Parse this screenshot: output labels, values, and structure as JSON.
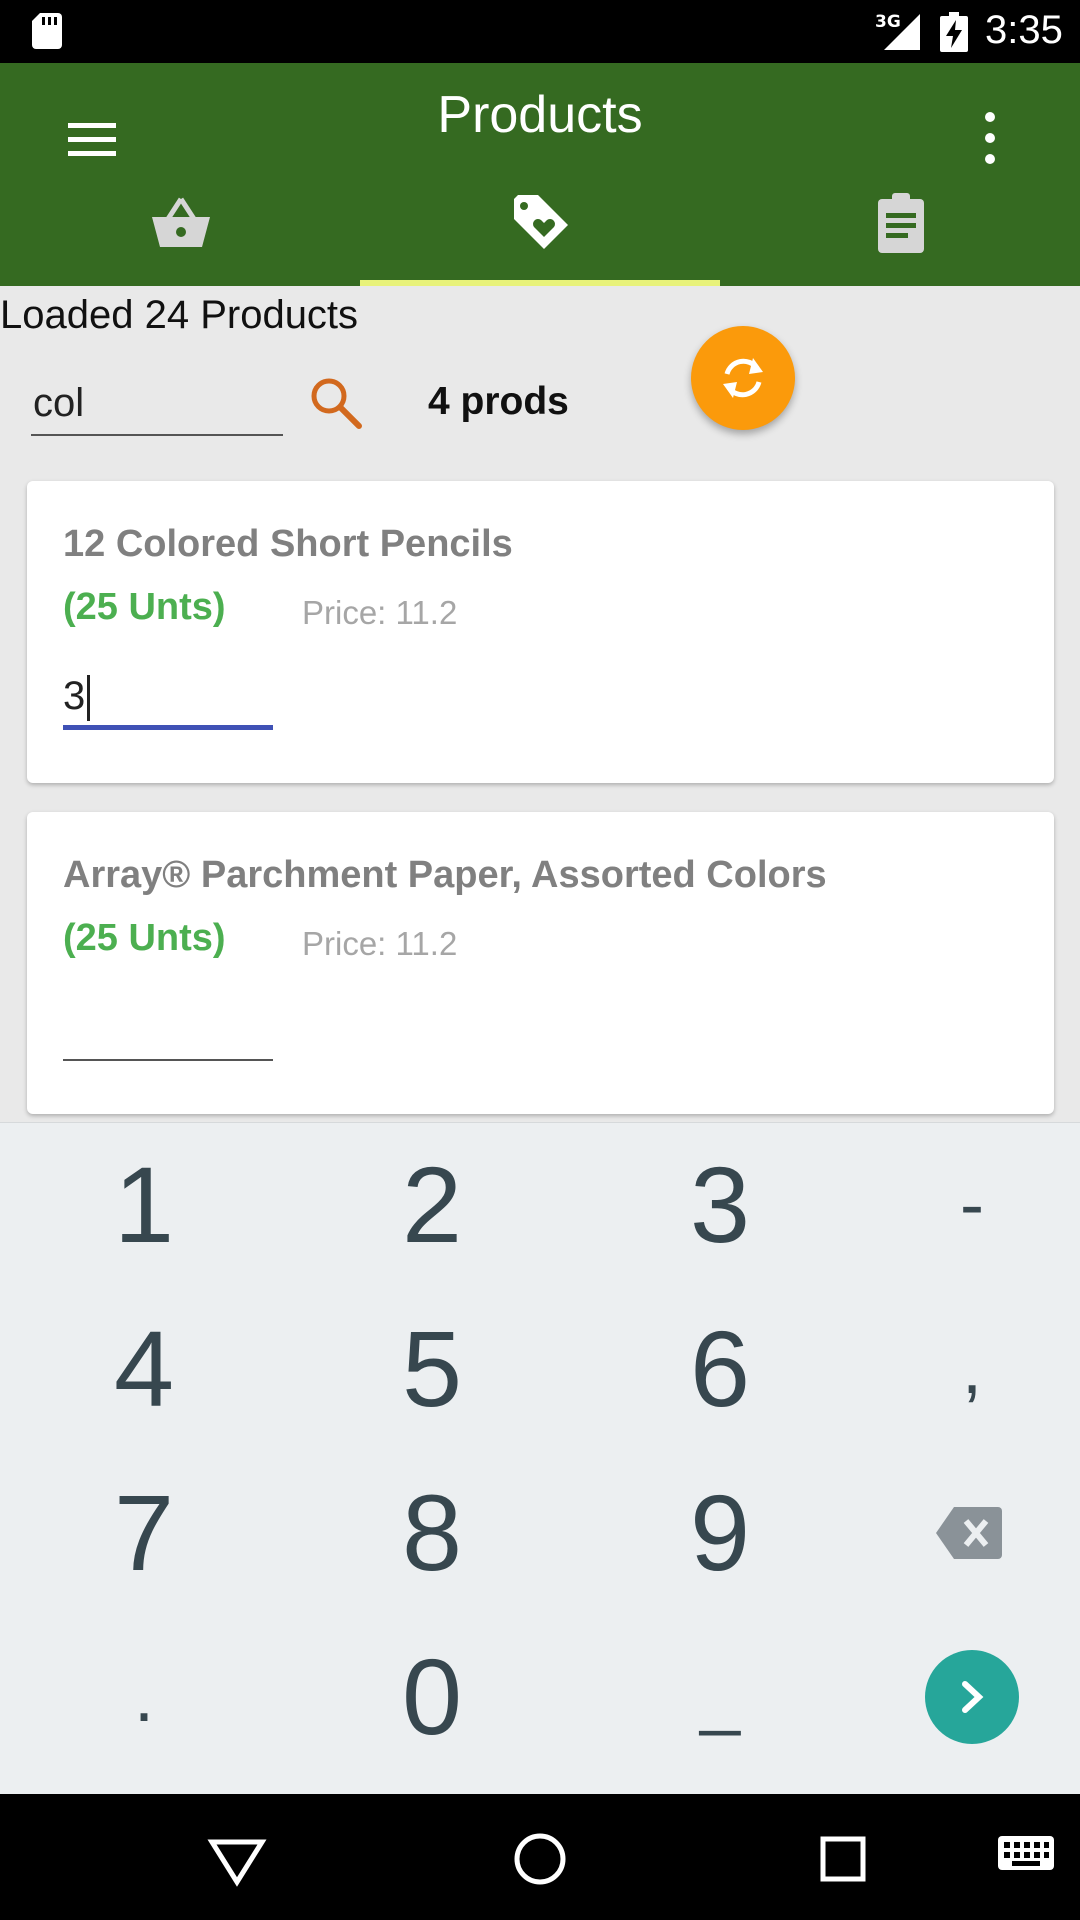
{
  "status_bar": {
    "network": "3G",
    "time": "3:35",
    "icons": [
      "sd-card-icon",
      "signal-icon",
      "battery-charging-icon"
    ]
  },
  "app_bar": {
    "title": "Products",
    "background_color": "#356a21",
    "tabs": [
      {
        "icon": "basket-icon",
        "selected": false
      },
      {
        "icon": "tag-heart-icon",
        "selected": true
      },
      {
        "icon": "clipboard-icon",
        "selected": false
      }
    ],
    "indicator_color": "#e8f27a"
  },
  "content": {
    "loaded_text": "Loaded 24 Products",
    "search": {
      "value": "col"
    },
    "product_count": "4 prods",
    "refresh_color": "#fb9a0b"
  },
  "products": [
    {
      "name": "12 Colored Short Pencils",
      "units": "(25 Unts)",
      "price": "Price: 11.2",
      "quantity": "3"
    },
    {
      "name": "Array® Parchment Paper, Assorted Colors",
      "units": "(25 Unts)",
      "price": "Price: 11.2",
      "quantity": ""
    }
  ],
  "keyboard": {
    "keys": [
      "1",
      "2",
      "3",
      "-",
      "4",
      "5",
      "6",
      ",",
      "7",
      "8",
      "9",
      ".",
      "0",
      "_"
    ],
    "enter_color": "#26a69a"
  }
}
